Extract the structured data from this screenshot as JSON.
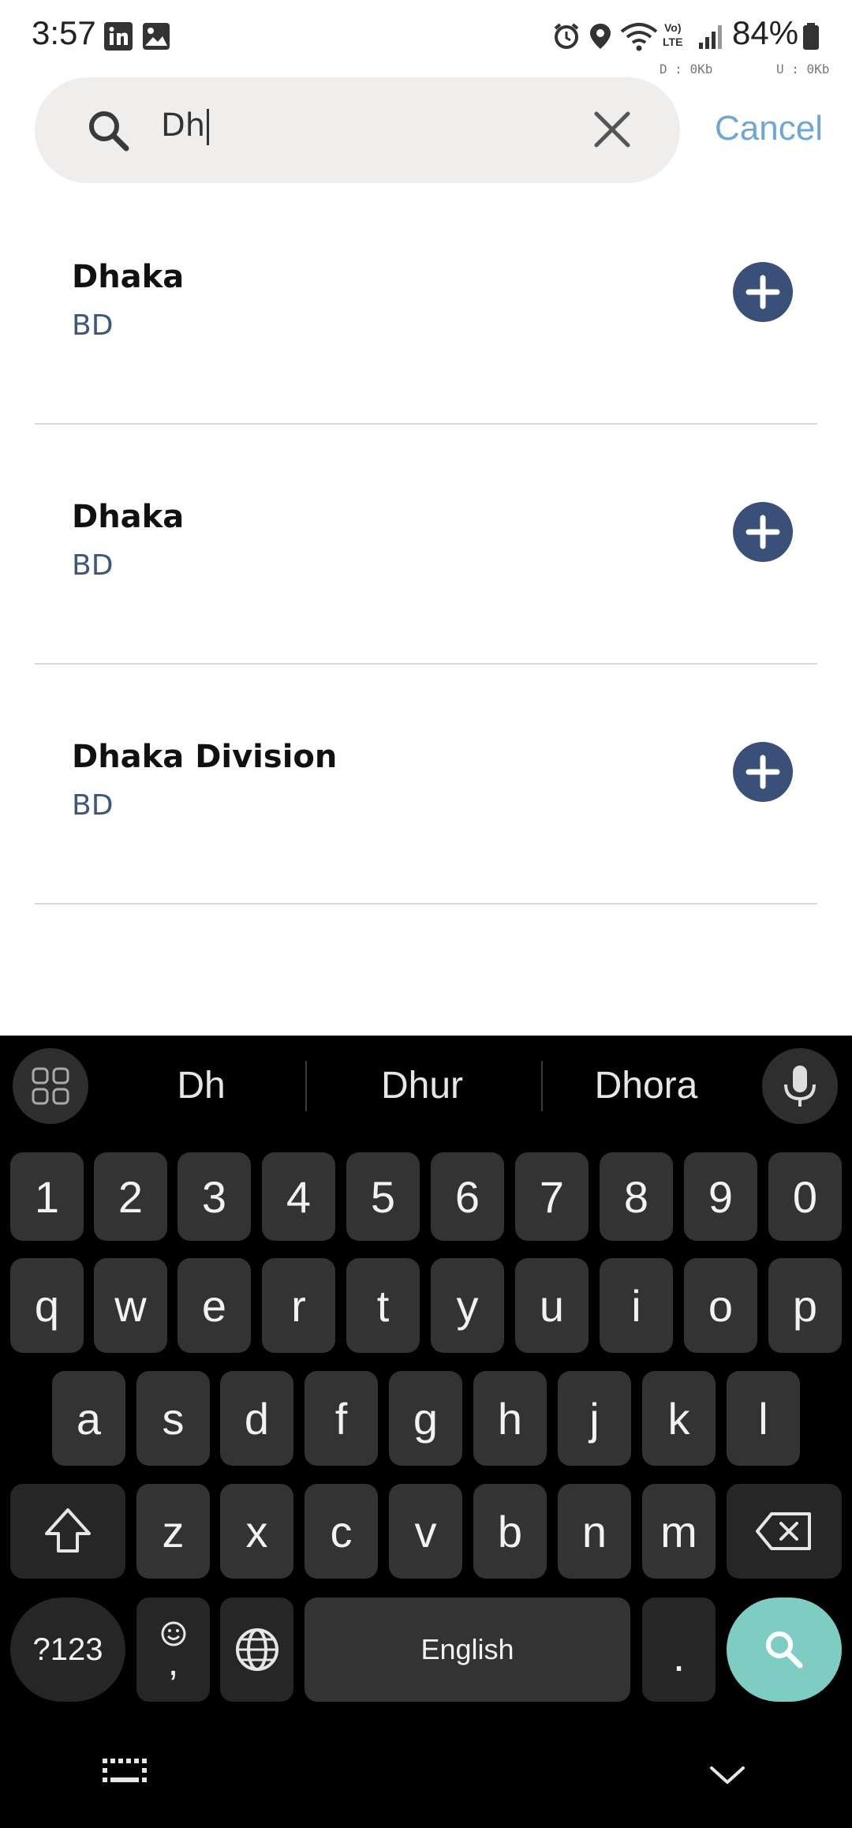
{
  "status_bar": {
    "time": "3:57",
    "battery": "84%",
    "net_down": "D : 0Kb",
    "net_up": "U : 0Kb",
    "icons": [
      "linkedin-icon",
      "gallery-icon",
      "alarm-icon",
      "location-icon",
      "wifi-icon",
      "volte-icon",
      "signal-icon",
      "battery-icon"
    ]
  },
  "search": {
    "value": "Dh",
    "cancel_label": "Cancel"
  },
  "results": [
    {
      "name": "Dhaka",
      "country": "BD"
    },
    {
      "name": "Dhaka",
      "country": "BD"
    },
    {
      "name": "Dhaka Division",
      "country": "BD"
    }
  ],
  "keyboard": {
    "suggestions": [
      "Dh",
      "Dhur",
      "Dhora"
    ],
    "number_row": [
      "1",
      "2",
      "3",
      "4",
      "5",
      "6",
      "7",
      "8",
      "9",
      "0"
    ],
    "row1": [
      "q",
      "w",
      "e",
      "r",
      "t",
      "y",
      "u",
      "i",
      "o",
      "p"
    ],
    "row2": [
      "a",
      "s",
      "d",
      "f",
      "g",
      "h",
      "j",
      "k",
      "l"
    ],
    "row3": [
      "z",
      "x",
      "c",
      "v",
      "b",
      "n",
      "m"
    ],
    "symbols_label": "?123",
    "comma_label": ",",
    "space_label": "English",
    "period_label": "."
  },
  "colors": {
    "accent_blue": "#6ea6d4",
    "add_button": "#3a5078",
    "search_key": "#7ecdc3",
    "keyboard_bg": "#000000",
    "key_bg": "#333333"
  }
}
